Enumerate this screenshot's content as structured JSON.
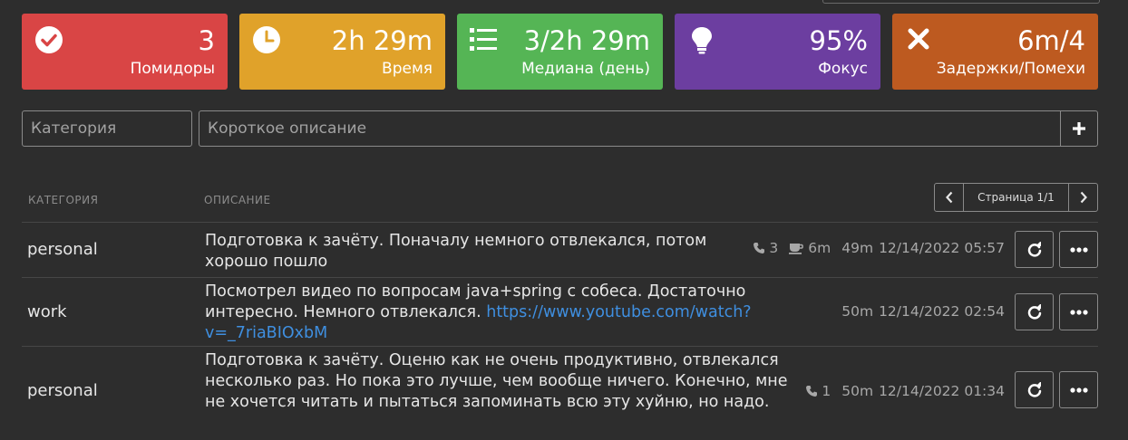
{
  "stats": [
    {
      "value": "3",
      "label": "Помидоры",
      "color": "#d94545",
      "icon": "check-circle-icon"
    },
    {
      "value": "2h 29m",
      "label": "Время",
      "color": "#e0a22a",
      "icon": "clock-icon"
    },
    {
      "value": "3/2h 29m",
      "label": "Медиана (день)",
      "color": "#55b555",
      "icon": "list-icon"
    },
    {
      "value": "95%",
      "label": "Фокус",
      "color": "#6c3ea0",
      "icon": "lightbulb-icon"
    },
    {
      "value": "6m/4",
      "label": "Задержки/Помехи",
      "color": "#bd5a20",
      "icon": "close-icon"
    }
  ],
  "form": {
    "category_placeholder": "Категория",
    "description_placeholder": "Короткое описание"
  },
  "table": {
    "col_category": "КАТЕГОРИЯ",
    "col_description": "ОПИСАНИЕ",
    "pager_text": "Страница 1/1"
  },
  "rows": [
    {
      "category": "personal",
      "text": "Подготовка к зачёту. Поначалу немного отвлекался, потом хорошо пошло",
      "link": "",
      "calls": "3",
      "breaks": "6m",
      "duration": "49m",
      "datetime": "12/14/2022 05:57"
    },
    {
      "category": "work",
      "text": "Посмотрел видео по вопросам java+spring с собеса. Достаточно интересно. Немного отвлекался.",
      "link": "https://www.youtube.com/watch?v=_7riaBIOxbM",
      "duration": "50m",
      "datetime": "12/14/2022 02:54"
    },
    {
      "category": "personal",
      "text": "Подготовка к зачёту. Оценю как не очень продуктивно, отвлекался несколько раз. Но пока это лучше, чем вообще ничего. Конечно, мне не хочется читать и пытаться запоминать всю эту хуйню, но надо.",
      "link": "",
      "calls": "1",
      "duration": "50m",
      "datetime": "12/14/2022 01:34"
    }
  ]
}
